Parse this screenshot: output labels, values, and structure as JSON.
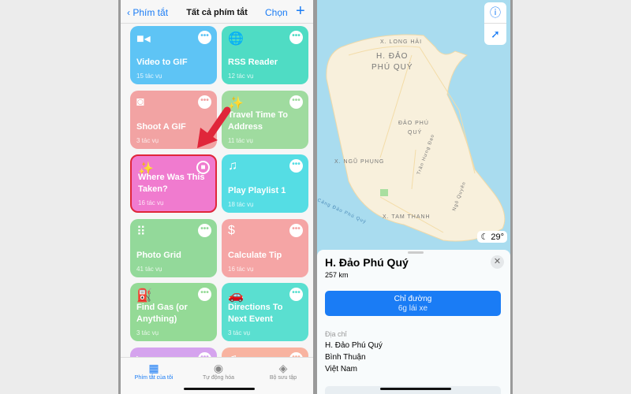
{
  "shortcuts": {
    "nav": {
      "back": "Phím tắt",
      "title": "Tất cả phím tắt",
      "select": "Chọn",
      "add": "+"
    },
    "cards": [
      {
        "name": "Video to GIF",
        "count": "15 tác vụ",
        "icon": "video-icon",
        "color": "#5ec4f5"
      },
      {
        "name": "RSS Reader",
        "count": "12 tác vụ",
        "icon": "globe-icon",
        "color": "#4fdcc4"
      },
      {
        "name": "Shoot A GIF",
        "count": "3 tác vụ",
        "icon": "camera-icon",
        "color": "#f2a3a3"
      },
      {
        "name": "Travel Time To Address",
        "count": "11 tác vụ",
        "icon": "magic-wand-icon",
        "color": "#9fdb9f"
      },
      {
        "name": "Where Was This Taken?",
        "count": "16 tác vụ",
        "icon": "magic-wand-icon",
        "color": "#f07bcf"
      },
      {
        "name": "Play Playlist 1",
        "count": "18 tác vụ",
        "icon": "music-note-icon",
        "color": "#55dde4"
      },
      {
        "name": "Photo Grid",
        "count": "41 tác vụ",
        "icon": "grid-icon",
        "color": "#93d99a"
      },
      {
        "name": "Calculate Tip",
        "count": "16 tác vụ",
        "icon": "dollar-icon",
        "color": "#f5a5a5"
      },
      {
        "name": "Find Gas (or Anything)",
        "count": "3 tác vụ",
        "icon": "fuel-icon",
        "color": "#94da96"
      },
      {
        "name": "Directions To Next Event",
        "count": "3 tác vụ",
        "icon": "car-icon",
        "color": "#5adfd0"
      },
      {
        "name": "",
        "count": "",
        "icon": "play-icon",
        "color": "#d5a3ee"
      },
      {
        "name": "",
        "count": "",
        "icon": "music-note-icon",
        "color": "#f8b3a0"
      }
    ],
    "tabs": [
      {
        "label": "Phím tắt của tôi",
        "active": true
      },
      {
        "label": "Tự động hóa"
      },
      {
        "label": "Bộ sưu tập"
      }
    ]
  },
  "map": {
    "labels": [
      "X. LONG HẢI",
      "H. ĐẢO",
      "PHÚ QUÝ",
      "ĐẢO PHÚ",
      "QUÝ",
      "X. NGŨ PHỤNG",
      "X. TAM THANH",
      "Trần Hưng Đạo",
      "Ngô Quyền",
      "Cảng Đảo Phú Quý"
    ],
    "weather": "29°",
    "place": {
      "title": "H. Đảo Phú Quý",
      "distance": "257 km",
      "directions": "Chỉ đường",
      "drive": "6g lái xe",
      "address_label": "Địa chỉ",
      "address": [
        "H. Đảo Phú Quý",
        "Bình Thuận",
        "Việt Nam"
      ]
    }
  },
  "colors": {
    "accent": "#1a7cf5",
    "highlight": "#e0263a"
  }
}
